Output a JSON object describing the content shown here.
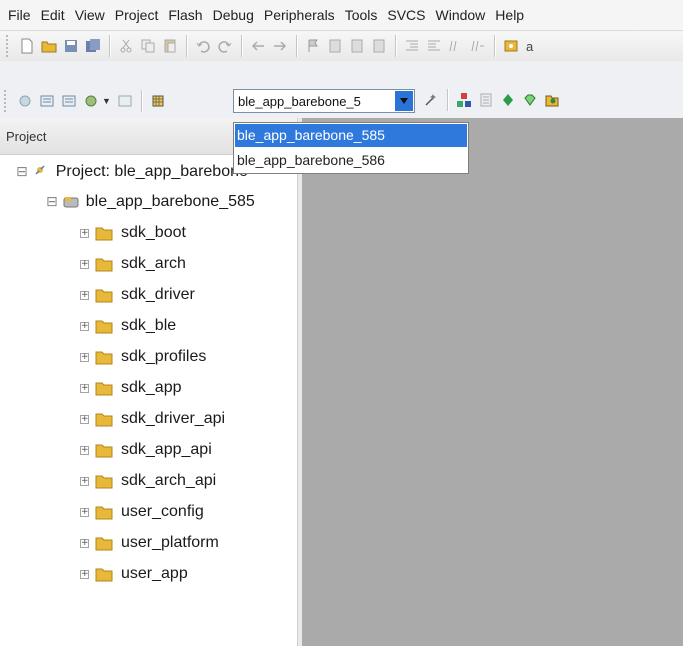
{
  "menu": [
    "File",
    "Edit",
    "View",
    "Project",
    "Flash",
    "Debug",
    "Peripherals",
    "Tools",
    "SVCS",
    "Window",
    "Help"
  ],
  "toolbar": {
    "tail_text": "a",
    "target_combo": {
      "value": "ble_app_barebone_5",
      "options": [
        "ble_app_barebone_585",
        "ble_app_barebone_586"
      ],
      "selected": "ble_app_barebone_585"
    }
  },
  "project_panel": {
    "title": "Project",
    "root": "Project: ble_app_barebone",
    "target": "ble_app_barebone_585",
    "groups": [
      "sdk_boot",
      "sdk_arch",
      "sdk_driver",
      "sdk_ble",
      "sdk_profiles",
      "sdk_app",
      "sdk_driver_api",
      "sdk_app_api",
      "sdk_arch_api",
      "user_config",
      "user_platform",
      "user_app"
    ]
  },
  "colors": {
    "selection": "#3079dc",
    "folder": "#e8b83a",
    "editor_bg": "#aaaaaa"
  }
}
